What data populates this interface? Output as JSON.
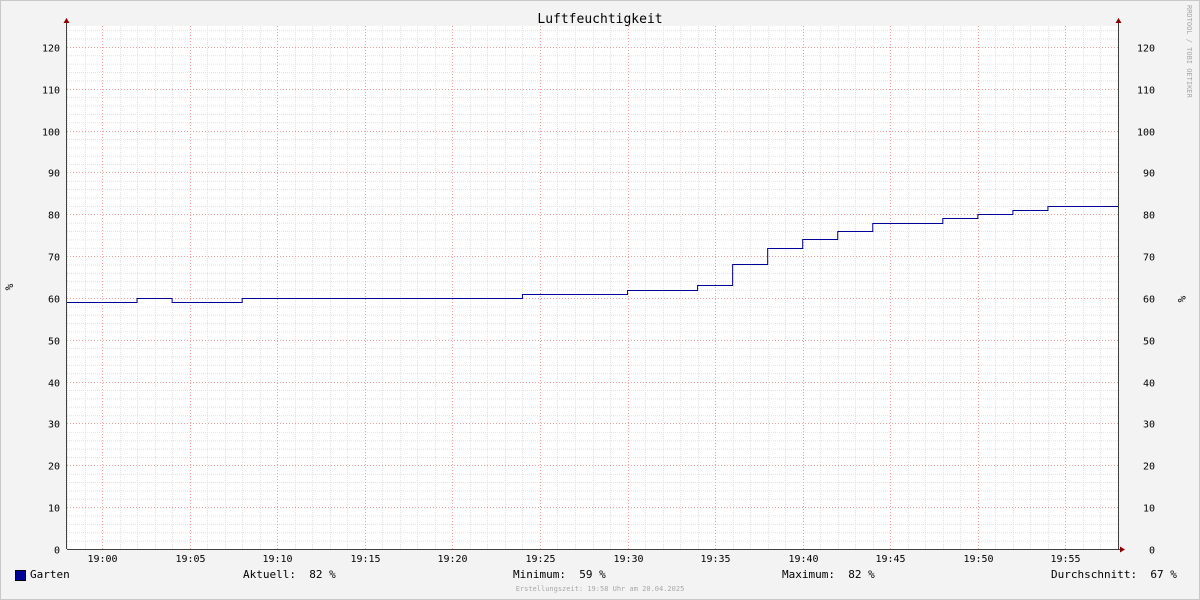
{
  "chart_data": {
    "type": "line",
    "title": "Luftfeuchtigkeit",
    "ylabel": "%",
    "ylim": [
      0,
      125
    ],
    "y_ticks": [
      0,
      10,
      20,
      30,
      40,
      50,
      60,
      70,
      80,
      90,
      100,
      110,
      120
    ],
    "x_tick_labels": [
      "19:00",
      "19:05",
      "19:10",
      "19:15",
      "19:20",
      "19:25",
      "19:30",
      "19:35",
      "19:40",
      "19:45",
      "19:50",
      "19:55"
    ],
    "x_tick_minutes": [
      0,
      5,
      10,
      15,
      20,
      25,
      30,
      35,
      40,
      45,
      50,
      55
    ],
    "x_range_minutes": [
      -2,
      58
    ],
    "grid": true,
    "series": [
      {
        "name": "Garten",
        "color": "#000096",
        "x": [
          -2,
          2,
          4,
          8,
          24,
          30,
          34,
          36,
          38,
          40,
          42,
          44,
          48,
          50,
          52,
          54,
          58
        ],
        "y": [
          59,
          60,
          59,
          60,
          61,
          62,
          63,
          68,
          72,
          74,
          76,
          78,
          79,
          80,
          81,
          82,
          82
        ]
      }
    ]
  },
  "legend": {
    "series_name": "Garten",
    "current": "Aktuell:  82 %",
    "minimum": "Minimum:  59 %",
    "maximum": "Maximum:  82 %",
    "average": "Durchschnitt:  67 %"
  },
  "watermark": "RRDTOOL / TOBI OETIKER",
  "footer": "Erstellungszeit: 19:58 Uhr am 20.04.2025"
}
